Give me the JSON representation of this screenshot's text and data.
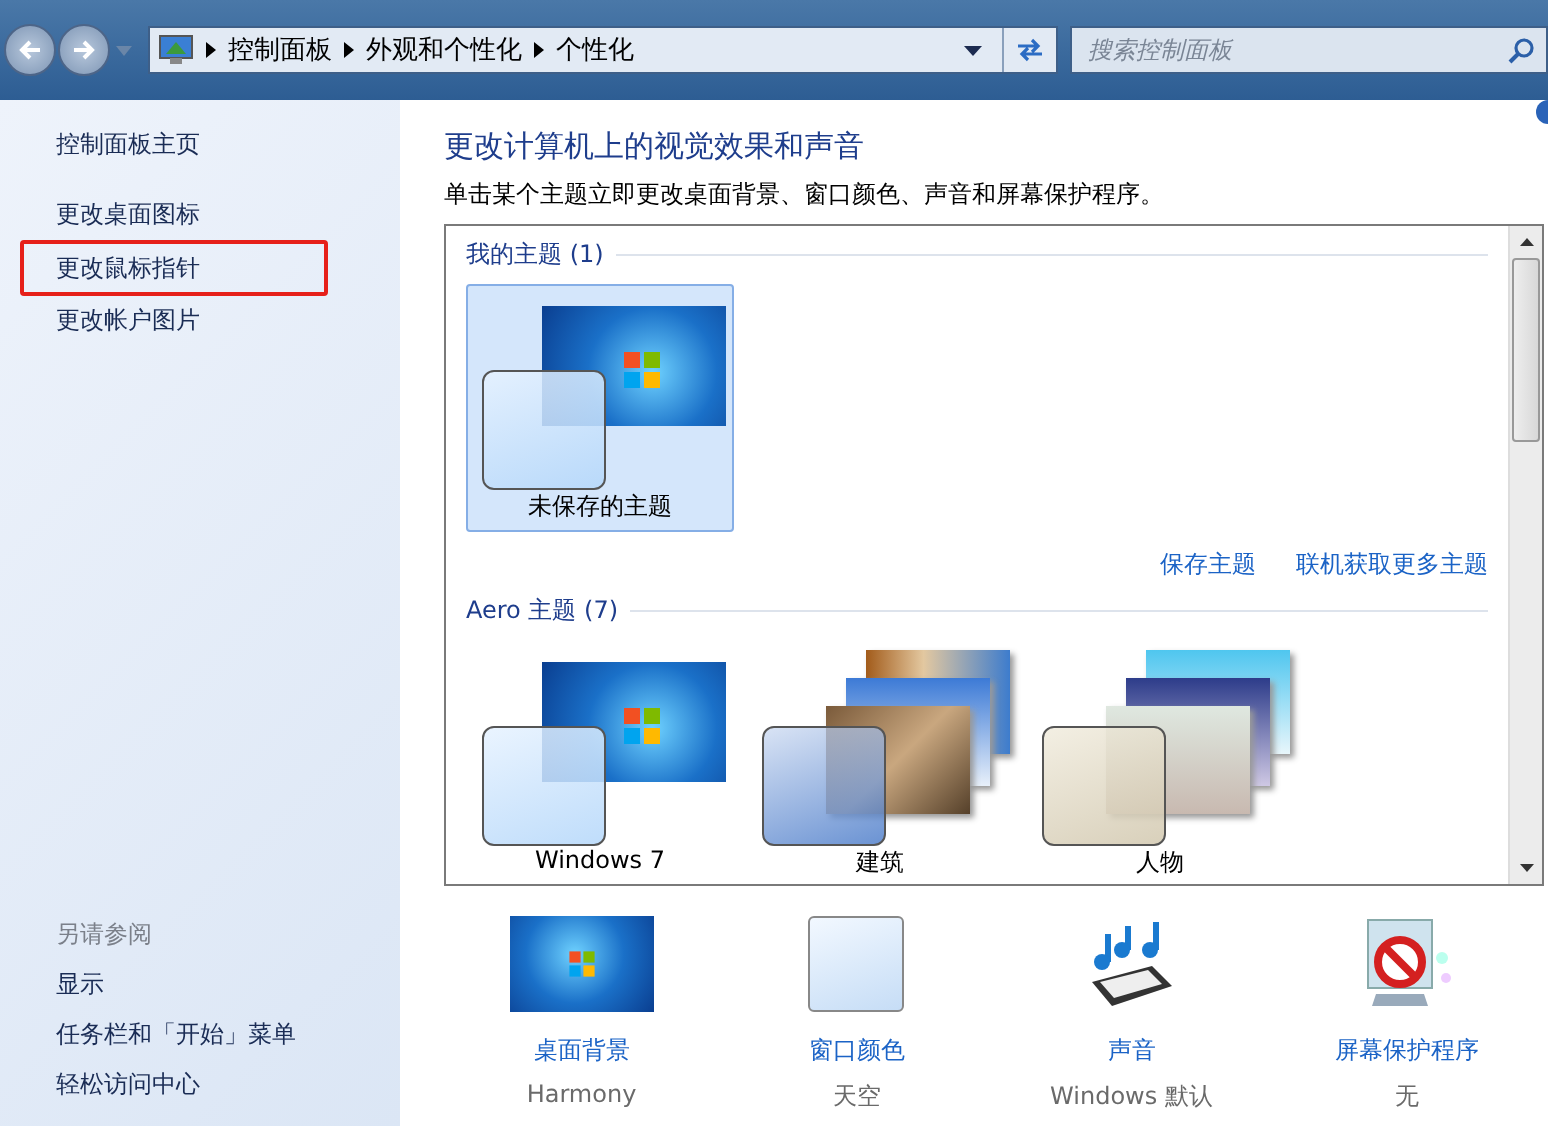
{
  "address_bar": {
    "breadcrumbs": [
      "控制面板",
      "外观和个性化",
      "个性化"
    ]
  },
  "search": {
    "placeholder": "搜索控制面板"
  },
  "sidebar": {
    "home": "控制面板主页",
    "items": [
      {
        "label": "更改桌面图标",
        "highlighted": false
      },
      {
        "label": "更改鼠标指针",
        "highlighted": true
      },
      {
        "label": "更改帐户图片",
        "highlighted": false
      }
    ],
    "see_also_title": "另请参阅",
    "see_also": [
      "显示",
      "任务栏和「开始」菜单",
      "轻松访问中心"
    ]
  },
  "main": {
    "title": "更改计算机上的视觉效果和声音",
    "description": "单击某个主题立即更改桌面背景、窗口颜色、声音和屏幕保护程序。",
    "groups": [
      {
        "title": "我的主题 (1)",
        "themes": [
          {
            "name": "未保存的主题",
            "kind": "win7",
            "selected": true
          }
        ],
        "links": [
          "保存主题",
          "联机获取更多主题"
        ]
      },
      {
        "title": "Aero 主题 (7)",
        "themes": [
          {
            "name": "Windows 7",
            "kind": "win7",
            "selected": false
          },
          {
            "name": "建筑",
            "kind": "architecture",
            "selected": false
          },
          {
            "name": "人物",
            "kind": "characters",
            "selected": false
          }
        ]
      }
    ]
  },
  "settings": [
    {
      "label": "桌面背景",
      "value": "Harmony",
      "kind": "background"
    },
    {
      "label": "窗口颜色",
      "value": "天空",
      "kind": "color"
    },
    {
      "label": "声音",
      "value": "Windows 默认",
      "kind": "sound"
    },
    {
      "label": "屏幕保护程序",
      "value": "无",
      "kind": "screensaver"
    }
  ]
}
